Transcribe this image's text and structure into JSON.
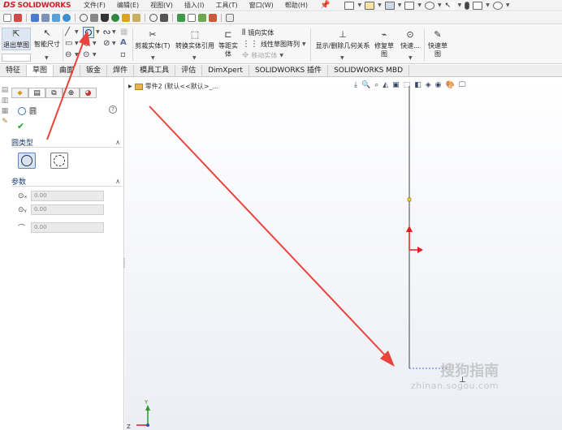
{
  "app": {
    "brand_ds": "DS",
    "brand_name": "SOLIDWORKS"
  },
  "menu": {
    "items": [
      "文件(F)",
      "编辑(E)",
      "视图(V)",
      "插入(I)",
      "工具(T)",
      "窗口(W)",
      "帮助(H)"
    ]
  },
  "ribbon": {
    "exit_sketch": "退出草图",
    "smart_dim": "智能尺寸",
    "trim": "剪裁实体(T)",
    "convert": "转换实体引用",
    "offset": "等距实体",
    "mirror": "镜向实体",
    "linear_pattern": "线性草图阵列",
    "move": "移动实体",
    "relations": "显示/删除几何关系",
    "repair": "修复草图",
    "quick_snaps": "快速...",
    "rapid_sketch": "快速草图"
  },
  "tabs": [
    "特征",
    "草图",
    "曲面",
    "钣金",
    "焊件",
    "模具工具",
    "评估",
    "DimXpert",
    "SOLIDWORKS 插件",
    "SOLIDWORKS MBD"
  ],
  "active_tab": "草图",
  "property_manager": {
    "title": "圆",
    "help": "?",
    "ok": "✔",
    "circle_type_label": "圆类型",
    "params_label": "参数",
    "params": [
      {
        "icon": "center-x-icon",
        "value": "0.00"
      },
      {
        "icon": "center-y-icon",
        "value": "0.00"
      },
      {
        "icon": "radius-icon",
        "value": "0.00"
      }
    ]
  },
  "graphics": {
    "tree_label": "零件2 (默认<<默认>_...",
    "axis_y": "Y",
    "axis_z": "Z",
    "watermark_main": "搜狗指南",
    "watermark_url": "zhinan.sogou.com"
  },
  "colors": {
    "annotation_arrow": "#e8443c",
    "brand": "#d32027",
    "axis_red": "#e02020"
  }
}
